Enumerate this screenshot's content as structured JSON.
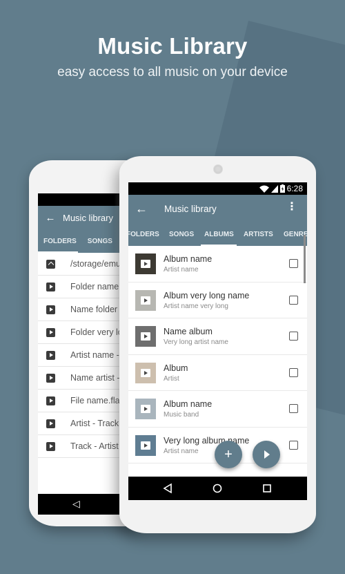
{
  "promo": {
    "title": "Music Library",
    "subtitle": "easy access to all music on your device"
  },
  "back_phone": {
    "appbar_title": "Music library",
    "tabs": [
      "FOLDERS",
      "SONGS",
      "A"
    ],
    "active_tab": "FOLDERS",
    "rows": [
      {
        "icon": "folder-up-icon",
        "label": "/storage/emul"
      },
      {
        "icon": "folder-play-icon",
        "label": "Folder name"
      },
      {
        "icon": "folder-play-icon",
        "label": "Name folder"
      },
      {
        "icon": "play-file-icon",
        "label": "Folder very lo"
      },
      {
        "icon": "play-file-icon",
        "label": "Artist name -"
      },
      {
        "icon": "play-file-icon",
        "label": "Name artist -"
      },
      {
        "icon": "play-file-icon",
        "label": "File name.fla"
      },
      {
        "icon": "play-file-icon",
        "label": "Artist - Track"
      },
      {
        "icon": "play-file-icon",
        "label": "Track - Artist"
      }
    ]
  },
  "front_phone": {
    "status": {
      "time": "6:28"
    },
    "appbar": {
      "title": "Music library",
      "back_icon": "arrow-left-icon",
      "menu_icon": "more-vert-icon"
    },
    "tabs": [
      "FOLDERS",
      "SONGS",
      "ALBUMS",
      "ARTISTS",
      "GENRES"
    ],
    "active_tab": "ALBUMS",
    "albums": [
      {
        "name": "Album name",
        "artist": "Artist name",
        "checked": false,
        "art": "#3d3a33"
      },
      {
        "name": "Album very long name",
        "artist": "Artist name very long",
        "checked": false,
        "art": "#b7b7b2"
      },
      {
        "name": "Name album",
        "artist": "Very long artist name",
        "checked": false,
        "art": "#6e6e6e"
      },
      {
        "name": "Album",
        "artist": "Artist",
        "checked": false,
        "art": "#cdbfae"
      },
      {
        "name": "Album name",
        "artist": "Music band",
        "checked": false,
        "art": "#a9b5bd"
      },
      {
        "name": "Very long album name",
        "artist": "Artist name",
        "checked": false,
        "art": "#5f7d92"
      }
    ],
    "fabs": {
      "add_label": "+",
      "play_icon": "play-icon"
    },
    "nav": [
      "back-icon",
      "home-icon",
      "recents-icon"
    ]
  },
  "colors": {
    "accent": "#617d8c",
    "background": "#617d8c"
  }
}
